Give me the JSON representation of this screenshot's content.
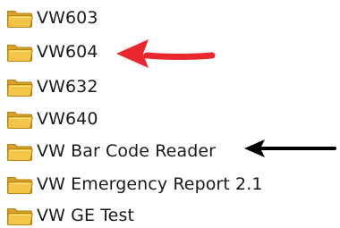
{
  "folders": [
    {
      "label": "VW603",
      "icon": "folder-icon"
    },
    {
      "label": "VW604",
      "icon": "folder-icon"
    },
    {
      "label": "VW632",
      "icon": "folder-icon"
    },
    {
      "label": "VW640",
      "icon": "folder-icon"
    },
    {
      "label": "VW Bar Code Reader",
      "icon": "folder-icon"
    },
    {
      "label": "VW Emergency Report 2.1",
      "icon": "folder-icon"
    },
    {
      "label": "VW GE Test",
      "icon": "folder-icon"
    }
  ],
  "annotations": {
    "red_arrow": {
      "color": "#e8282d",
      "points_to": "VW604"
    },
    "black_arrow": {
      "color": "#000000",
      "points_to": "VW Bar Code Reader"
    }
  },
  "colors": {
    "folder_front": "#f2c447",
    "folder_back": "#d8a22a",
    "folder_edge": "#b88112"
  }
}
